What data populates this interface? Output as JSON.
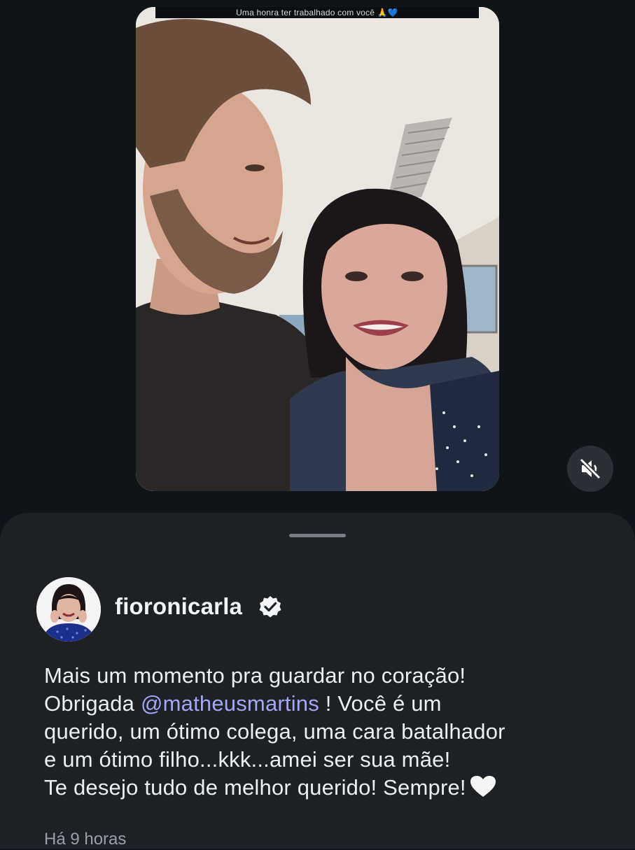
{
  "story": {
    "caption_overlay": "Uma honra ter trabalhado com você 🙏💙",
    "mute_icon": "speaker-muted-icon"
  },
  "post": {
    "username": "fioronicarla",
    "verified_icon": "verified-badge-icon",
    "caption_lines": {
      "line1": "Mais um momento pra guardar no coração!",
      "line2_prefix": "Obrigada ",
      "mention": "@matheusmartins",
      "line2_suffix": " ! Você é um",
      "line3": "querido, um ótimo colega, uma cara batalhador",
      "line4": "e um ótimo filho...kkk...amei ser sua mãe!",
      "line5": "Te desejo tudo de melhor querido! Sempre!"
    },
    "heart_icon": "white-heart-icon",
    "timestamp": "Há 9 horas"
  },
  "colors": {
    "background": "#0f1419",
    "sheet": "#1d2125",
    "mention": "#a3a8f5",
    "text": "#eceef0",
    "muted_text": "#9aa0a6"
  }
}
